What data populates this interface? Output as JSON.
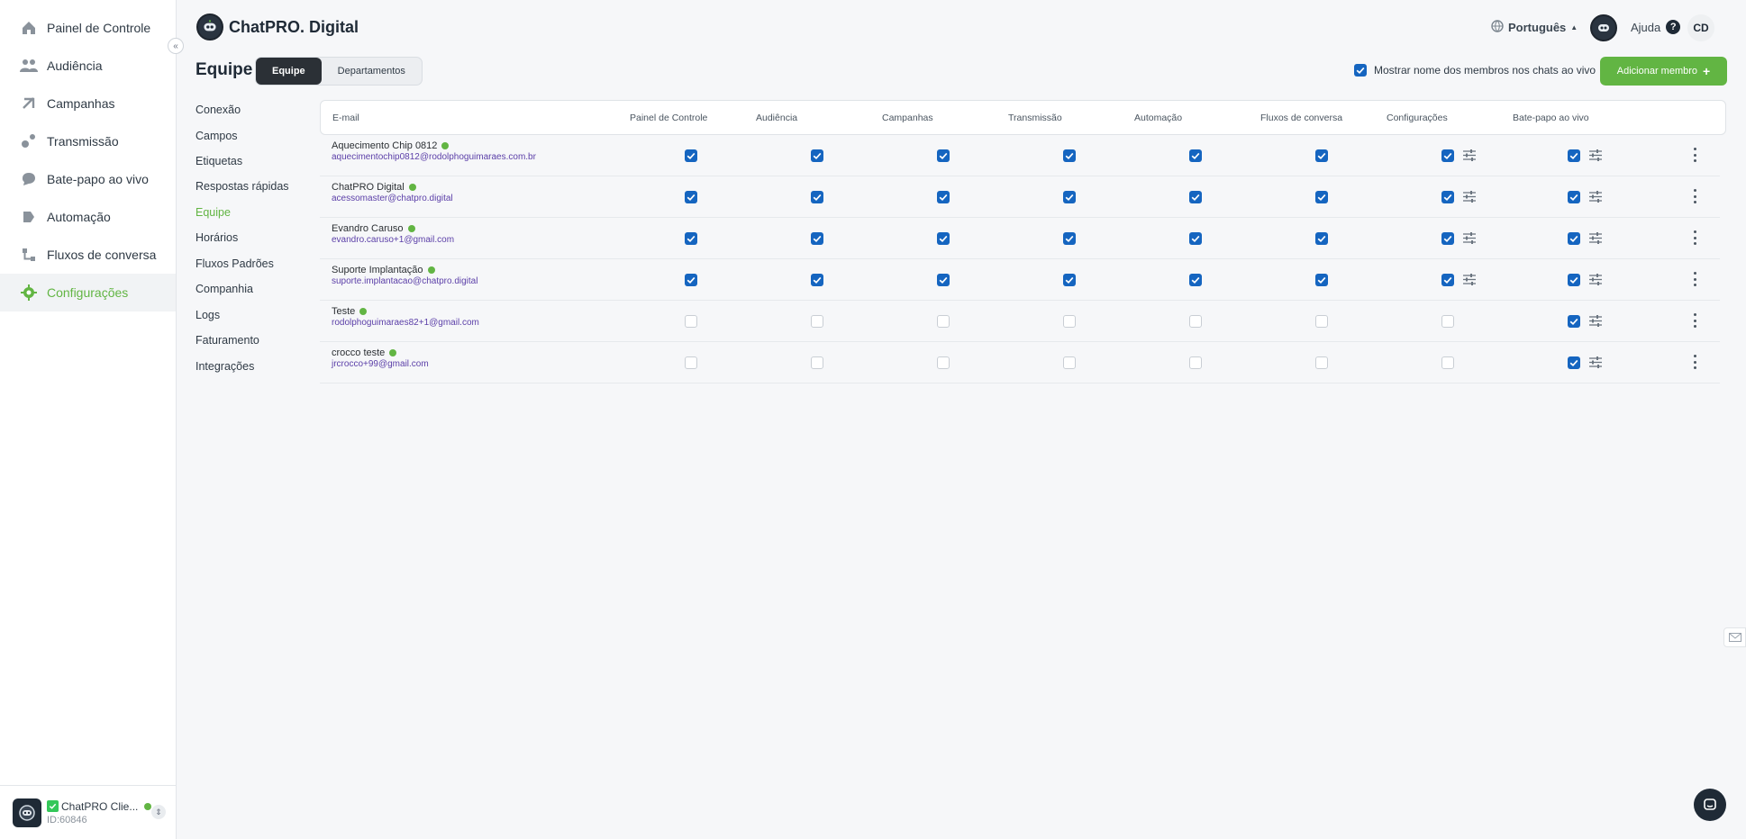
{
  "sidebar": {
    "items": [
      {
        "label": "Painel de Controle",
        "icon": "home-icon"
      },
      {
        "label": "Audiência",
        "icon": "people-icon"
      },
      {
        "label": "Campanhas",
        "icon": "campaign-icon"
      },
      {
        "label": "Transmissão",
        "icon": "broadcast-icon"
      },
      {
        "label": "Bate-papo ao vivo",
        "icon": "chat-bubble-icon"
      },
      {
        "label": "Automação",
        "icon": "automation-icon"
      },
      {
        "label": "Fluxos de conversa",
        "icon": "flow-icon"
      },
      {
        "label": "Configurações",
        "icon": "gear-icon",
        "active": true
      }
    ],
    "account": {
      "name": "ChatPRO Clie...",
      "id": "ID:60846"
    }
  },
  "header": {
    "brand": "ChatPRO. Digital",
    "language": "Português",
    "help": "Ajuda",
    "initials": "CD"
  },
  "page": {
    "title": "Equipe",
    "tabs": [
      "Equipe",
      "Departamentos"
    ],
    "active_tab": "Equipe",
    "show_names_label": "Mostrar nome dos membros nos chats ao vivo",
    "show_names_checked": true,
    "add_member_label": "Adicionar membro"
  },
  "settings_menu": [
    "Conexão",
    "Campos",
    "Etiquetas",
    "Respostas rápidas",
    "Equipe",
    "Horários",
    "Fluxos Padrões",
    "Companhia",
    "Logs",
    "Faturamento",
    "Integrações"
  ],
  "settings_menu_active": "Equipe",
  "table": {
    "columns": [
      "E-mail",
      "Painel de Controle",
      "Audiência",
      "Campanhas",
      "Transmissão",
      "Automação",
      "Fluxos de conversa",
      "Configurações",
      "Bate-papo ao vivo"
    ],
    "rows": [
      {
        "name": "Aquecimento Chip 0812",
        "email": "aquecimentochip0812@rodolphoguimaraes.com.br",
        "perms": [
          true,
          true,
          true,
          true,
          true,
          true,
          true,
          true
        ]
      },
      {
        "name": "ChatPRO Digital",
        "email": "acessomaster@chatpro.digital",
        "perms": [
          true,
          true,
          true,
          true,
          true,
          true,
          true,
          true
        ]
      },
      {
        "name": "Evandro Caruso",
        "email": "evandro.caruso+1@gmail.com",
        "perms": [
          true,
          true,
          true,
          true,
          true,
          true,
          true,
          true
        ]
      },
      {
        "name": "Suporte Implantação",
        "email": "suporte.implantacao@chatpro.digital",
        "perms": [
          true,
          true,
          true,
          true,
          true,
          true,
          true,
          true
        ]
      },
      {
        "name": "Teste",
        "email": "rodolphoguimaraes82+1@gmail.com",
        "perms": [
          false,
          false,
          false,
          false,
          false,
          false,
          false,
          true
        ]
      },
      {
        "name": "crocco teste",
        "email": "jrcrocco+99@gmail.com",
        "perms": [
          false,
          false,
          false,
          false,
          false,
          false,
          false,
          true
        ]
      }
    ]
  },
  "colors": {
    "accent": "#62b543",
    "checkbox": "#1565c0",
    "email": "#5b3fa8",
    "dark": "#2b3036"
  }
}
